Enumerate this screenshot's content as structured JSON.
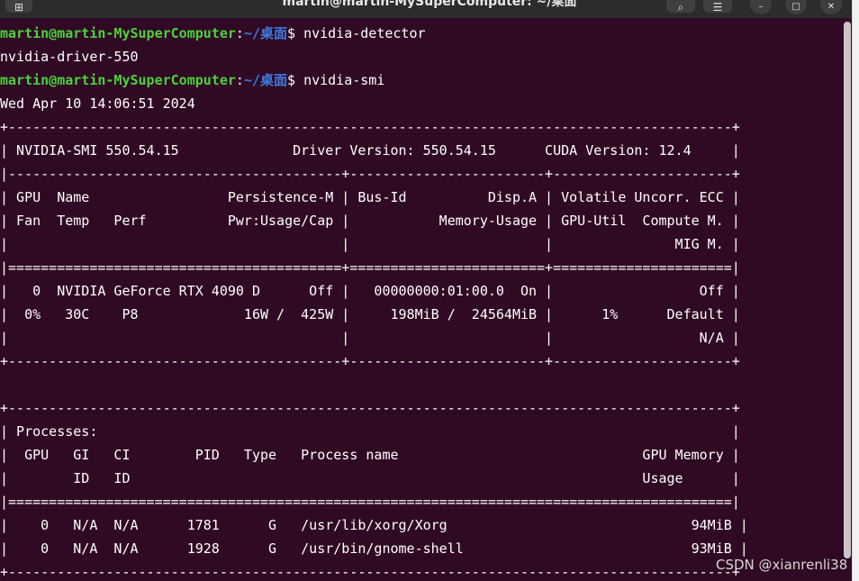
{
  "window": {
    "title": "martin@martin-MySuperComputer: ~/桌面",
    "new_tab_icon": "new-tab-icon",
    "buttons": [
      "search-icon",
      "menu-icon",
      "minimize-icon",
      "maximize-icon",
      "close-icon"
    ]
  },
  "prompt": {
    "user_host": "martin@martin-MySuperComputer",
    "separator": ":",
    "path": "~/桌面",
    "symbol": "$ "
  },
  "commands": {
    "first": "nvidia-detector",
    "second": "nvidia-smi"
  },
  "output": {
    "detector": "nvidia-driver-550",
    "timestamp": "Wed Apr 10 14:06:51 2024"
  },
  "smi_table": [
    "+-----------------------------------------------------------------------------------------+",
    "| NVIDIA-SMI 550.54.15              Driver Version: 550.54.15      CUDA Version: 12.4     |",
    "|-----------------------------------------+------------------------+----------------------+",
    "| GPU  Name                 Persistence-M | Bus-Id          Disp.A | Volatile Uncorr. ECC |",
    "| Fan  Temp   Perf          Pwr:Usage/Cap |           Memory-Usage | GPU-Util  Compute M. |",
    "|                                         |                        |               MIG M. |",
    "|=========================================+========================+======================|",
    "|   0  NVIDIA GeForce RTX 4090 D      Off |   00000000:01:00.0  On |                  Off |",
    "|  0%   30C    P8             16W /  425W |     198MiB /  24564MiB |      1%      Default |",
    "|                                         |                        |                  N/A |",
    "+-----------------------------------------+------------------------+----------------------+"
  ],
  "processes_table": [
    "+-----------------------------------------------------------------------------------------+",
    "| Processes:                                                                              |",
    "|  GPU   GI   CI        PID   Type   Process name                              GPU Memory |",
    "|        ID   ID                                                               Usage      |",
    "|=========================================================================================|",
    "|    0   N/A  N/A      1781      G   /usr/lib/xorg/Xorg                              94MiB |",
    "|    0   N/A  N/A      1928      G   /usr/bin/gnome-shell                            93MiB |",
    "+-----------------------------------------------------------------------------------------+"
  ],
  "watermark": "CSDN @xianrenli38"
}
